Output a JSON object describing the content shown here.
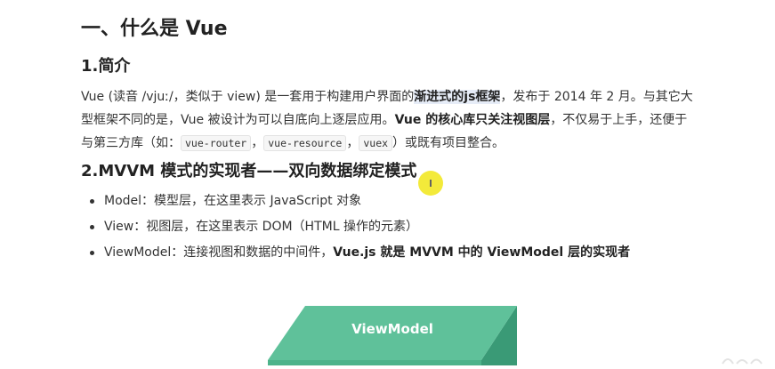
{
  "heading": "一、什么是 Vue",
  "intro": {
    "title": "1.简介",
    "p_t1": "Vue (读音 /vjuː/，类似于 view) 是一套用于构建用户界面的",
    "p_b1": "渐进式的js框架",
    "p_t2": "，发布于 2014 年 2 月。与其它大型框架不同的是，Vue 被设计为可以自底向上逐层应用。",
    "p_b2": "Vue 的核心库只关注视图层",
    "p_t3": "，不仅易于上手，还便于与第三方库（如：",
    "code1": "vue-router",
    "sep1": "，",
    "code2": "vue-resource",
    "sep2": "，",
    "code3": "vuex",
    "p_t4": "）或既有项目整合。"
  },
  "mvvm": {
    "title": "2.MVVM 模式的实现者——双向数据绑定模式",
    "items": [
      {
        "text": "Model：模型层，在这里表示 JavaScript 对象",
        "bold": ""
      },
      {
        "text": "View：视图层，在这里表示 DOM（HTML 操作的元素）",
        "bold": ""
      },
      {
        "text": "ViewModel：连接视图和数据的中间件，",
        "bold": "Vue.js 就是 MVVM 中的 ViewModel 层的实现者"
      }
    ]
  },
  "diagram": {
    "label": "ViewModel",
    "colors": {
      "top": "#5fc19a",
      "side": "#3a9a76",
      "front": "#4db38b"
    }
  }
}
